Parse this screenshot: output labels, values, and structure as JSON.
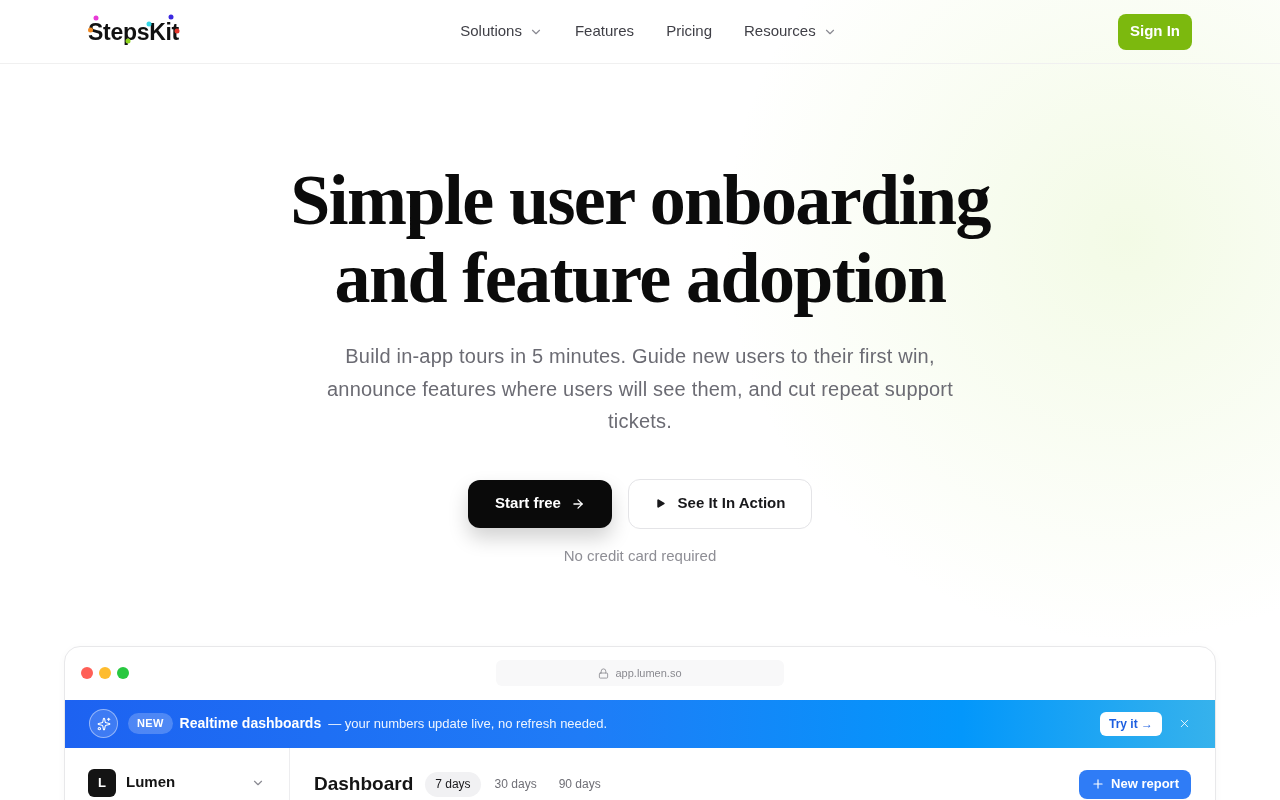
{
  "header": {
    "logo": "StepsKit",
    "nav": [
      {
        "label": "Solutions",
        "dropdown": true
      },
      {
        "label": "Features",
        "dropdown": false
      },
      {
        "label": "Pricing",
        "dropdown": false
      },
      {
        "label": "Resources",
        "dropdown": true
      }
    ],
    "sign_in": "Sign In"
  },
  "hero": {
    "title": "Simple user onboarding and feature adoption",
    "subtitle": "Build in-app tours in 5 minutes. Guide new users to their first win, announce features where users will see them, and cut repeat support tickets.",
    "primary_cta": "Start free",
    "secondary_cta": "See It In Action",
    "note": "No credit card required"
  },
  "preview": {
    "url": "app.lumen.so",
    "banner": {
      "badge": "NEW",
      "title": "Realtime dashboards",
      "text": "— your numbers update live, no refresh needed.",
      "action": "Try it →"
    },
    "workspace": {
      "initial": "L",
      "name": "Lumen"
    },
    "page_title": "Dashboard",
    "ranges": [
      {
        "label": "7 days",
        "selected": true
      },
      {
        "label": "30 days",
        "selected": false
      },
      {
        "label": "90 days",
        "selected": false
      }
    ],
    "new_report": "New report"
  }
}
